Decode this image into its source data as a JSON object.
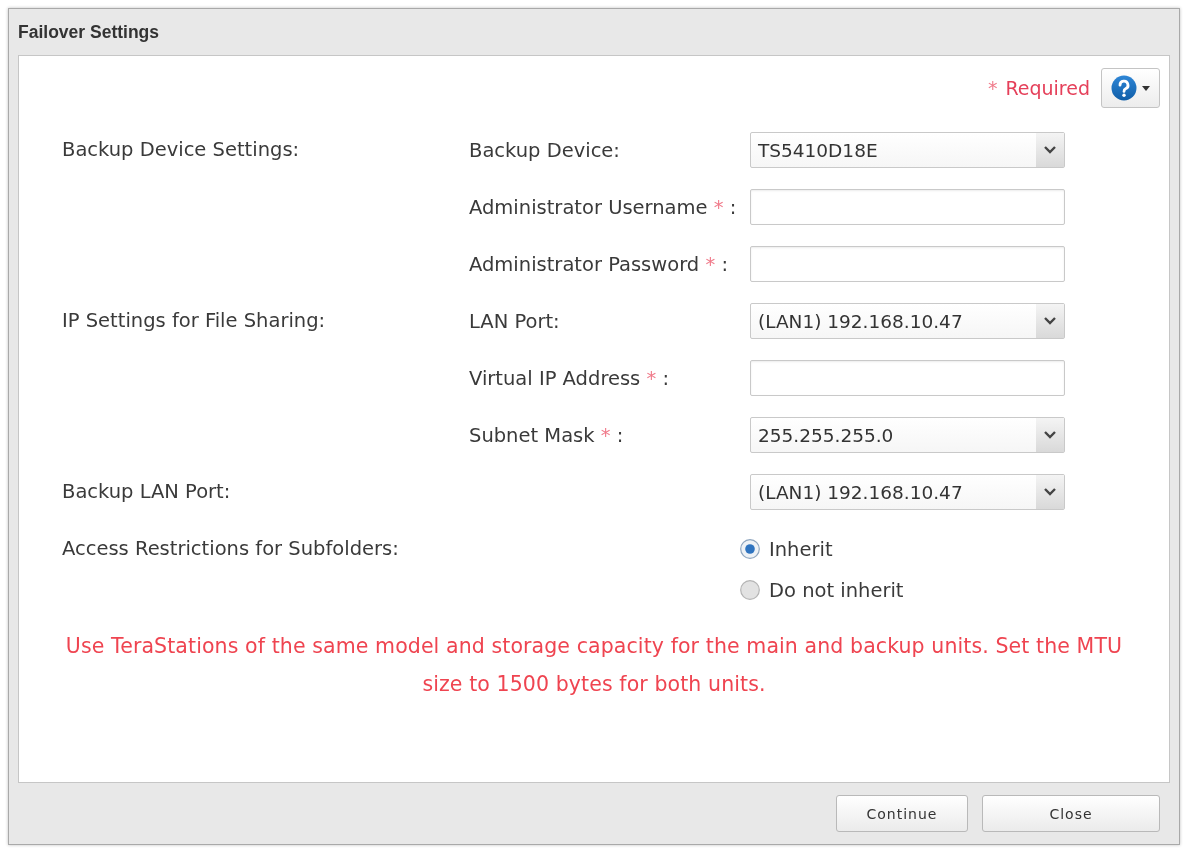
{
  "window": {
    "title": "Failover Settings"
  },
  "required_legend": {
    "mark": "*",
    "label": "Required"
  },
  "sections": [
    {
      "label": "Backup Device Settings:",
      "fields": [
        {
          "kind": "select",
          "label": "Backup Device:",
          "value": "TS5410D18E"
        },
        {
          "kind": "text",
          "label": "Administrator Username",
          "required_mark": "*",
          "colon": ":"
        },
        {
          "kind": "text",
          "label": "Administrator Password",
          "required_mark": "*",
          "colon": ":"
        }
      ]
    },
    {
      "label": "IP Settings for File Sharing:",
      "fields": [
        {
          "kind": "select",
          "label": "LAN Port:",
          "value": "(LAN1) 192.168.10.47"
        },
        {
          "kind": "text",
          "label": "Virtual IP Address",
          "required_mark": "*",
          "colon": ":"
        },
        {
          "kind": "select",
          "label": "Subnet Mask",
          "required_mark": "*",
          "colon": ":",
          "value": "255.255.255.0"
        }
      ]
    },
    {
      "label": "Backup LAN Port:",
      "control": {
        "kind": "select",
        "value": "(LAN1) 192.168.10.47"
      }
    },
    {
      "label": "Access Restrictions for Subfolders:",
      "control": {
        "kind": "radio",
        "options": [
          {
            "label": "Inherit",
            "selected": true
          },
          {
            "label": "Do not inherit",
            "selected": false
          }
        ]
      }
    }
  ],
  "notice": "Use TeraStations of the same model and storage capacity for the main and backup units. Set the MTU size to 1500 bytes for both units.",
  "buttons": [
    {
      "label": "Continue"
    },
    {
      "label": "Close"
    }
  ]
}
